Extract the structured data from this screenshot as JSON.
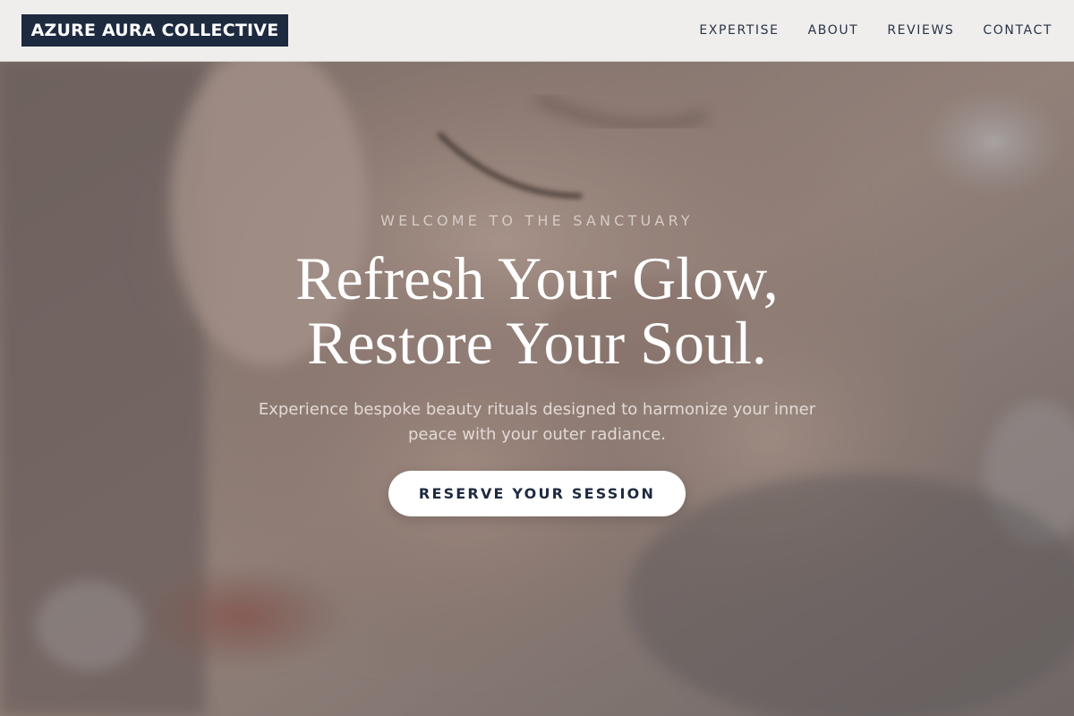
{
  "brand": {
    "name": "AZURE AURA COLLECTIVE",
    "color": "#1e2a40"
  },
  "nav": {
    "items": [
      {
        "label": "EXPERTISE"
      },
      {
        "label": "ABOUT"
      },
      {
        "label": "REVIEWS"
      },
      {
        "label": "CONTACT"
      }
    ]
  },
  "hero": {
    "background": "face-closeup-photo",
    "eyebrow": "WELCOME TO THE SANCTUARY",
    "headline_line1": "Refresh Your Glow,",
    "headline_line2": "Restore Your Soul.",
    "subline": "Experience bespoke beauty rituals designed to harmonize your inner peace with your outer radiance.",
    "cta_label": "RESERVE YOUR SESSION"
  }
}
